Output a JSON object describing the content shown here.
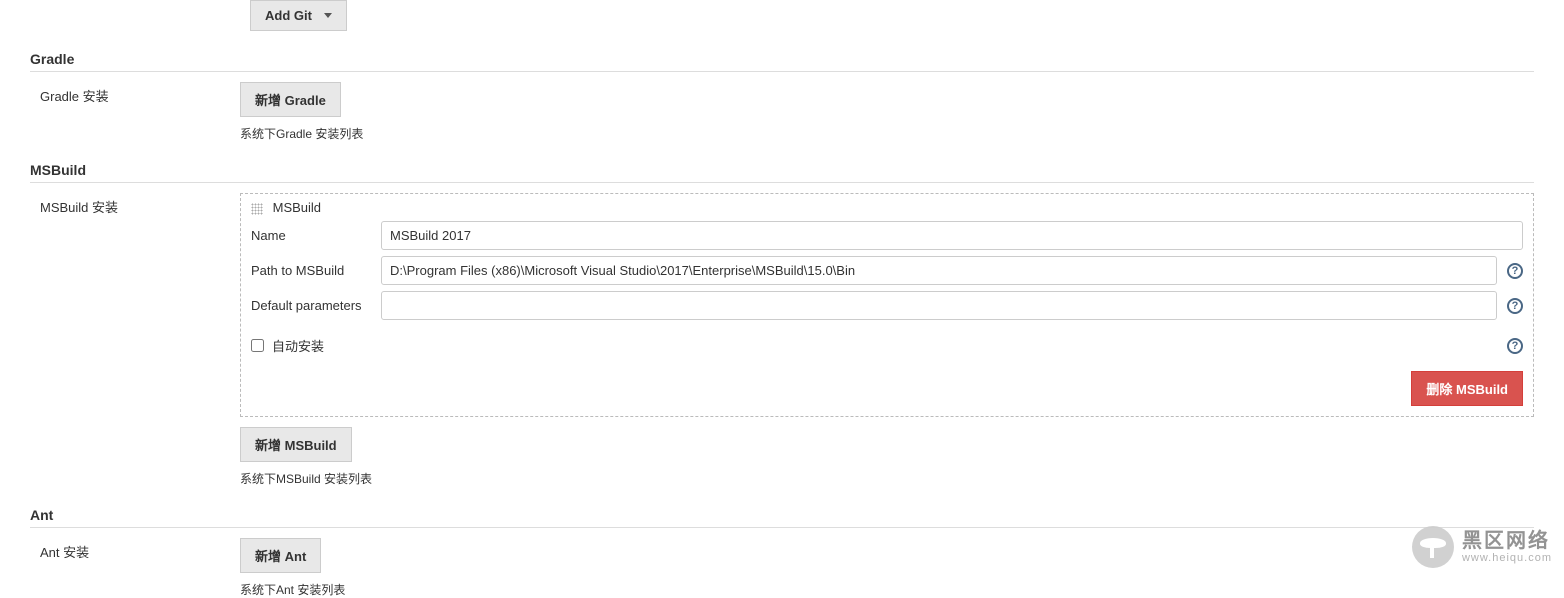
{
  "add_git": {
    "label": "Add Git"
  },
  "gradle": {
    "title": "Gradle",
    "install_label": "Gradle 安装",
    "add_button": "新增 Gradle",
    "desc": "系统下Gradle 安装列表"
  },
  "msbuild": {
    "title": "MSBuild",
    "install_label": "MSBuild 安装",
    "box_title": "MSBuild",
    "name_label": "Name",
    "name_value": "MSBuild 2017",
    "path_label": "Path to MSBuild",
    "path_value": "D:\\Program Files (x86)\\Microsoft Visual Studio\\2017\\Enterprise\\MSBuild\\15.0\\Bin",
    "default_params_label": "Default parameters",
    "default_params_value": "",
    "auto_install_label": "自动安装",
    "delete_button": "删除 MSBuild",
    "add_button": "新增 MSBuild",
    "desc": "系统下MSBuild 安装列表"
  },
  "ant": {
    "title": "Ant",
    "install_label": "Ant 安装",
    "add_button": "新增 Ant",
    "desc": "系统下Ant 安装列表"
  },
  "watermark": {
    "zh": "黑区网络",
    "en": "www.heiqu.com"
  }
}
